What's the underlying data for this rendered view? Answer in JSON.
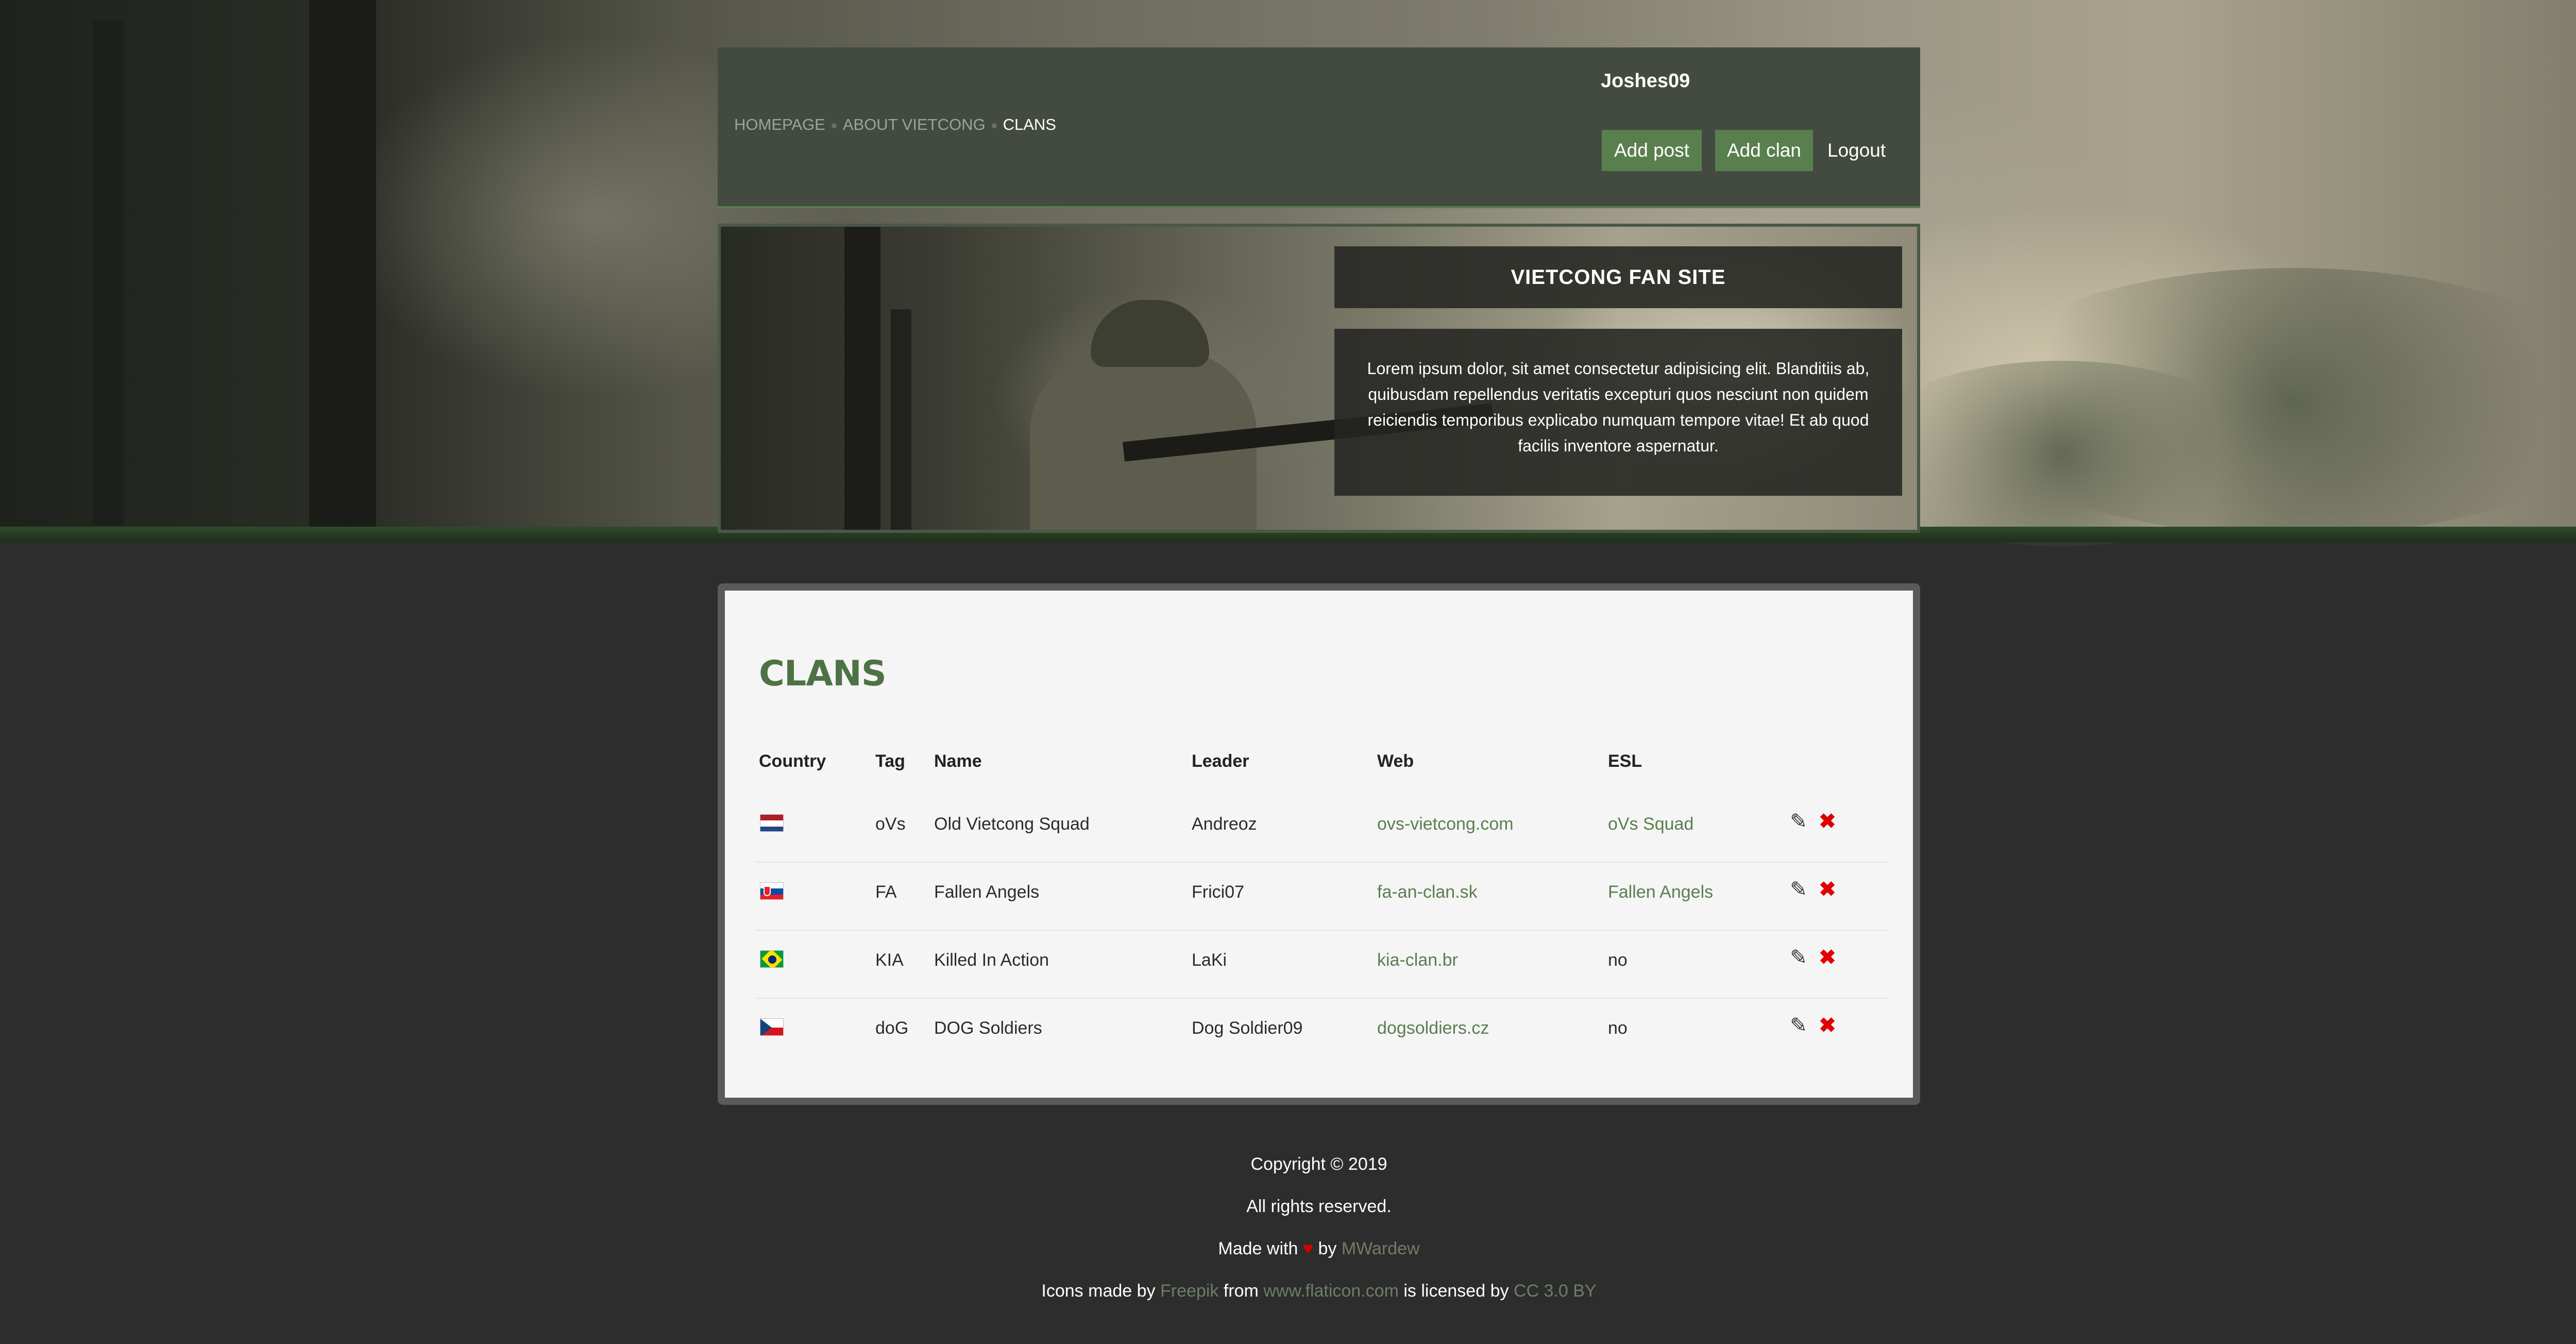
{
  "header": {
    "nav": [
      {
        "label": "HOMEPAGE"
      },
      {
        "label": "ABOUT VIETCONG"
      },
      {
        "label": "CLANS"
      }
    ],
    "username": "Joshes09",
    "add_post_label": "Add post",
    "add_clan_label": "Add clan",
    "logout_label": "Logout"
  },
  "banner": {
    "title": "VIETCONG FAN SITE",
    "text": "Lorem ipsum dolor, sit amet consectetur adipisicing elit. Blanditiis ab, quibusdam repellendus veritatis excepturi quos nesciunt non quidem reiciendis temporibus explicabo numquam tempore vitae! Et ab quod facilis inventore aspernatur."
  },
  "clans": {
    "title": "CLANS",
    "columns": [
      "Country",
      "Tag",
      "Name",
      "Leader",
      "Web",
      "ESL"
    ],
    "rows": [
      {
        "country": "Netherlands",
        "tag": "oVs",
        "name": "Old Vietcong Squad",
        "leader": "Andreoz",
        "web": "ovs-vietcong.com",
        "esl": "oVs Squad"
      },
      {
        "country": "Slovakia",
        "tag": "FA",
        "name": "Fallen Angels",
        "leader": "Frici07",
        "web": "fa-an-clan.sk",
        "esl": "Fallen Angels"
      },
      {
        "country": "Brazil",
        "tag": "KIA",
        "name": "Killed In Action",
        "leader": "LaKi",
        "web": "kia-clan.br",
        "esl": "no"
      },
      {
        "country": "Czech Republic",
        "tag": "doG",
        "name": "DOG Soldiers",
        "leader": "Dog Soldier09",
        "web": "dogsoldiers.cz",
        "esl": "no"
      }
    ],
    "edit_icon": "pencil-icon",
    "delete_icon": "cross-icon"
  },
  "footer": {
    "copyright": "Copyright © 2019",
    "rights": "All rights reserved.",
    "made_with_prefix": "Made with",
    "made_with_by": "by",
    "author": "MWardew",
    "icons_prefix": "Icons made by",
    "icons_author": "Freepik",
    "icons_from": "from",
    "icons_site": "www.flaticon.com",
    "icons_license_prefix": "is licensed by",
    "icons_license": "CC 3.0 BY"
  },
  "colors": {
    "accent_green": "#5a7f4f",
    "header_bg": "#434b40",
    "page_bg": "#2d2d2d",
    "delete_red": "#e00000"
  }
}
